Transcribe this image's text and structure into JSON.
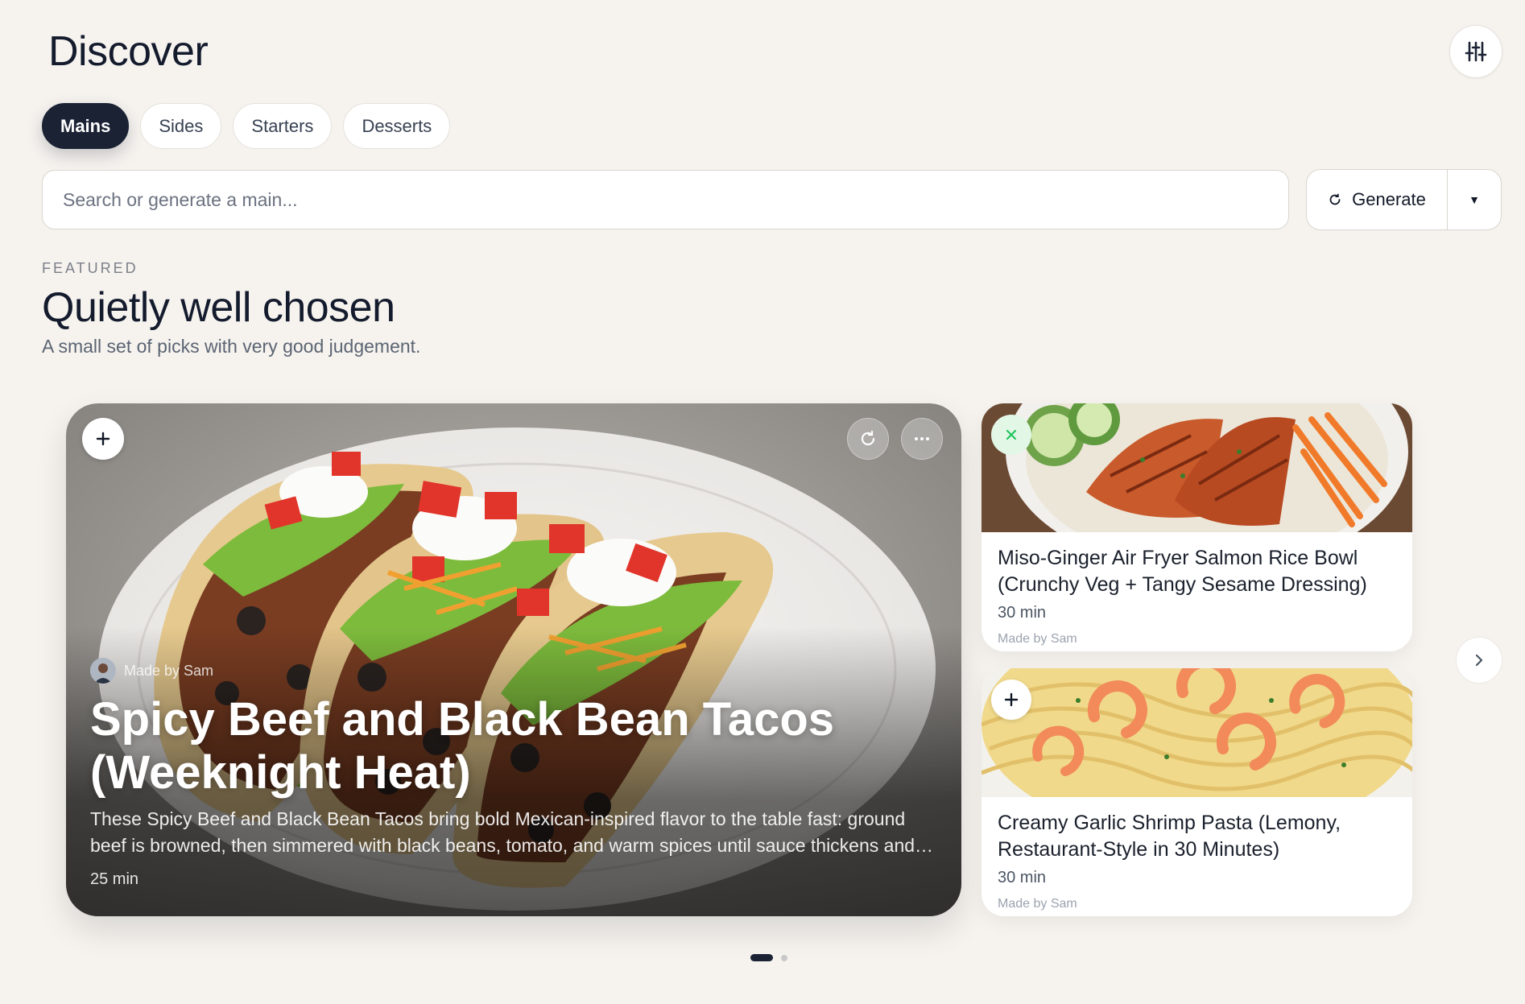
{
  "header": {
    "title": "Discover"
  },
  "settings": {
    "icon": "sliders-icon"
  },
  "tabs": [
    {
      "label": "Mains",
      "active": true
    },
    {
      "label": "Sides",
      "active": false
    },
    {
      "label": "Starters",
      "active": false
    },
    {
      "label": "Desserts",
      "active": false
    }
  ],
  "search": {
    "placeholder": "Search or generate a main...",
    "value": ""
  },
  "generate": {
    "label": "Generate",
    "icon": "refresh-icon",
    "caret_icon": "caret-down-icon"
  },
  "featured": {
    "eyebrow": "FEATURED",
    "title": "Quietly well chosen",
    "subtitle": "A small set of picks with very good judgement."
  },
  "hero": {
    "author": "Made by Sam",
    "title": "Spicy Beef and Black Bean Tacos (Weeknight Heat)",
    "description": "These Spicy Beef and Black Bean Tacos bring bold Mexican-inspired flavor to the table fast: ground beef is browned, then simmered with black beans, tomato, and warm spices until sauce thickens and everything is coated in rich, smoky heat.",
    "time": "25 min"
  },
  "cards": [
    {
      "title": "Miso-Ginger Air Fryer Salmon Rice Bowl (Crunchy Veg + Tangy Sesame Dressing)",
      "time": "30 min",
      "author": "Made by Sam",
      "action_icon": "close-icon"
    },
    {
      "title": "Creamy Garlic Shrimp Pasta (Lemony, Restaurant-Style in 30 Minutes)",
      "time": "30 min",
      "author": "Made by Sam",
      "action_icon": "plus-icon"
    }
  ],
  "carousel": {
    "page": 1,
    "pages": 2
  },
  "colors": {
    "background": "#f6f3ef",
    "accent": "#1b2234",
    "remove": "#22c55e"
  }
}
